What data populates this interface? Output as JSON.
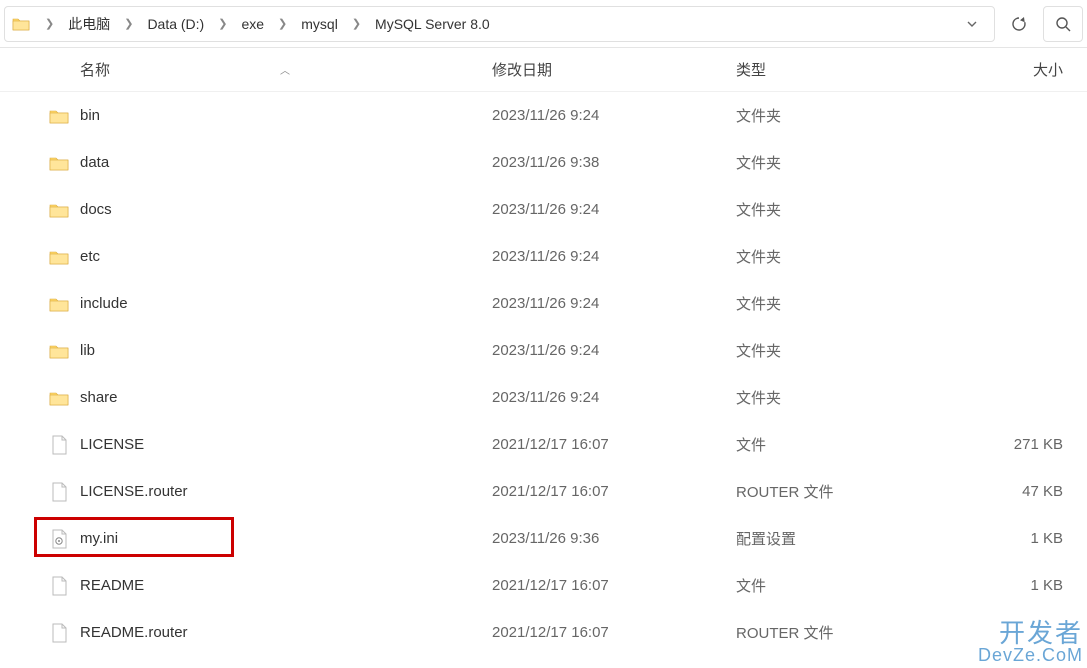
{
  "breadcrumb": {
    "items": [
      "此电脑",
      "Data (D:)",
      "exe",
      "mysql",
      "MySQL Server 8.0"
    ]
  },
  "columns": {
    "name": "名称",
    "date": "修改日期",
    "type": "类型",
    "size": "大小"
  },
  "highlighted_index": 9,
  "files": [
    {
      "name": "bin",
      "date": "2023/11/26 9:24",
      "type": "文件夹",
      "size": "",
      "icon": "folder"
    },
    {
      "name": "data",
      "date": "2023/11/26 9:38",
      "type": "文件夹",
      "size": "",
      "icon": "folder"
    },
    {
      "name": "docs",
      "date": "2023/11/26 9:24",
      "type": "文件夹",
      "size": "",
      "icon": "folder"
    },
    {
      "name": "etc",
      "date": "2023/11/26 9:24",
      "type": "文件夹",
      "size": "",
      "icon": "folder"
    },
    {
      "name": "include",
      "date": "2023/11/26 9:24",
      "type": "文件夹",
      "size": "",
      "icon": "folder"
    },
    {
      "name": "lib",
      "date": "2023/11/26 9:24",
      "type": "文件夹",
      "size": "",
      "icon": "folder"
    },
    {
      "name": "share",
      "date": "2023/11/26 9:24",
      "type": "文件夹",
      "size": "",
      "icon": "folder"
    },
    {
      "name": "LICENSE",
      "date": "2021/12/17 16:07",
      "type": "文件",
      "size": "271 KB",
      "icon": "file"
    },
    {
      "name": "LICENSE.router",
      "date": "2021/12/17 16:07",
      "type": "ROUTER 文件",
      "size": "47 KB",
      "icon": "file"
    },
    {
      "name": "my.ini",
      "date": "2023/11/26 9:36",
      "type": "配置设置",
      "size": "1 KB",
      "icon": "ini"
    },
    {
      "name": "README",
      "date": "2021/12/17 16:07",
      "type": "文件",
      "size": "1 KB",
      "icon": "file"
    },
    {
      "name": "README.router",
      "date": "2021/12/17 16:07",
      "type": "ROUTER 文件",
      "size": "",
      "icon": "file"
    }
  ],
  "watermark": {
    "line1": "开发者",
    "line2": "DevZe.CoM"
  }
}
